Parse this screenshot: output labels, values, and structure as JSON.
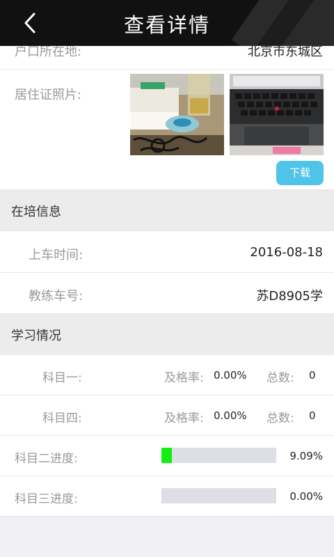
{
  "header": {
    "title": "查看详情",
    "back_icon": "chevron-left-icon"
  },
  "residence": {
    "label": "户口所在地:",
    "value": "北京市东城区"
  },
  "photos": {
    "label": "居住证照片:",
    "download_label": "下载",
    "download_color": "#4fc3e8"
  },
  "training_section": {
    "title": "在培信息",
    "rows": [
      {
        "label": "上车时间:",
        "value": "2016-08-18"
      },
      {
        "label": "教练车号:",
        "value": "苏D8905学"
      }
    ]
  },
  "study_section": {
    "title": "学习情况",
    "subjects": [
      {
        "label": "科目一:",
        "pass_rate_label": "及格率:",
        "pass_rate": "0.00%",
        "total_label": "总数:",
        "total": "0"
      },
      {
        "label": "科目四:",
        "pass_rate_label": "及格率:",
        "pass_rate": "0.00%",
        "total_label": "总数:",
        "total": "0"
      }
    ],
    "progress": [
      {
        "label": "科目二进度:",
        "percent_text": "9.09%",
        "fraction": 0.0909
      },
      {
        "label": "科目三进度:",
        "percent_text": "0.00%",
        "fraction": 0.0
      }
    ],
    "progress_color": "#11ee11"
  }
}
